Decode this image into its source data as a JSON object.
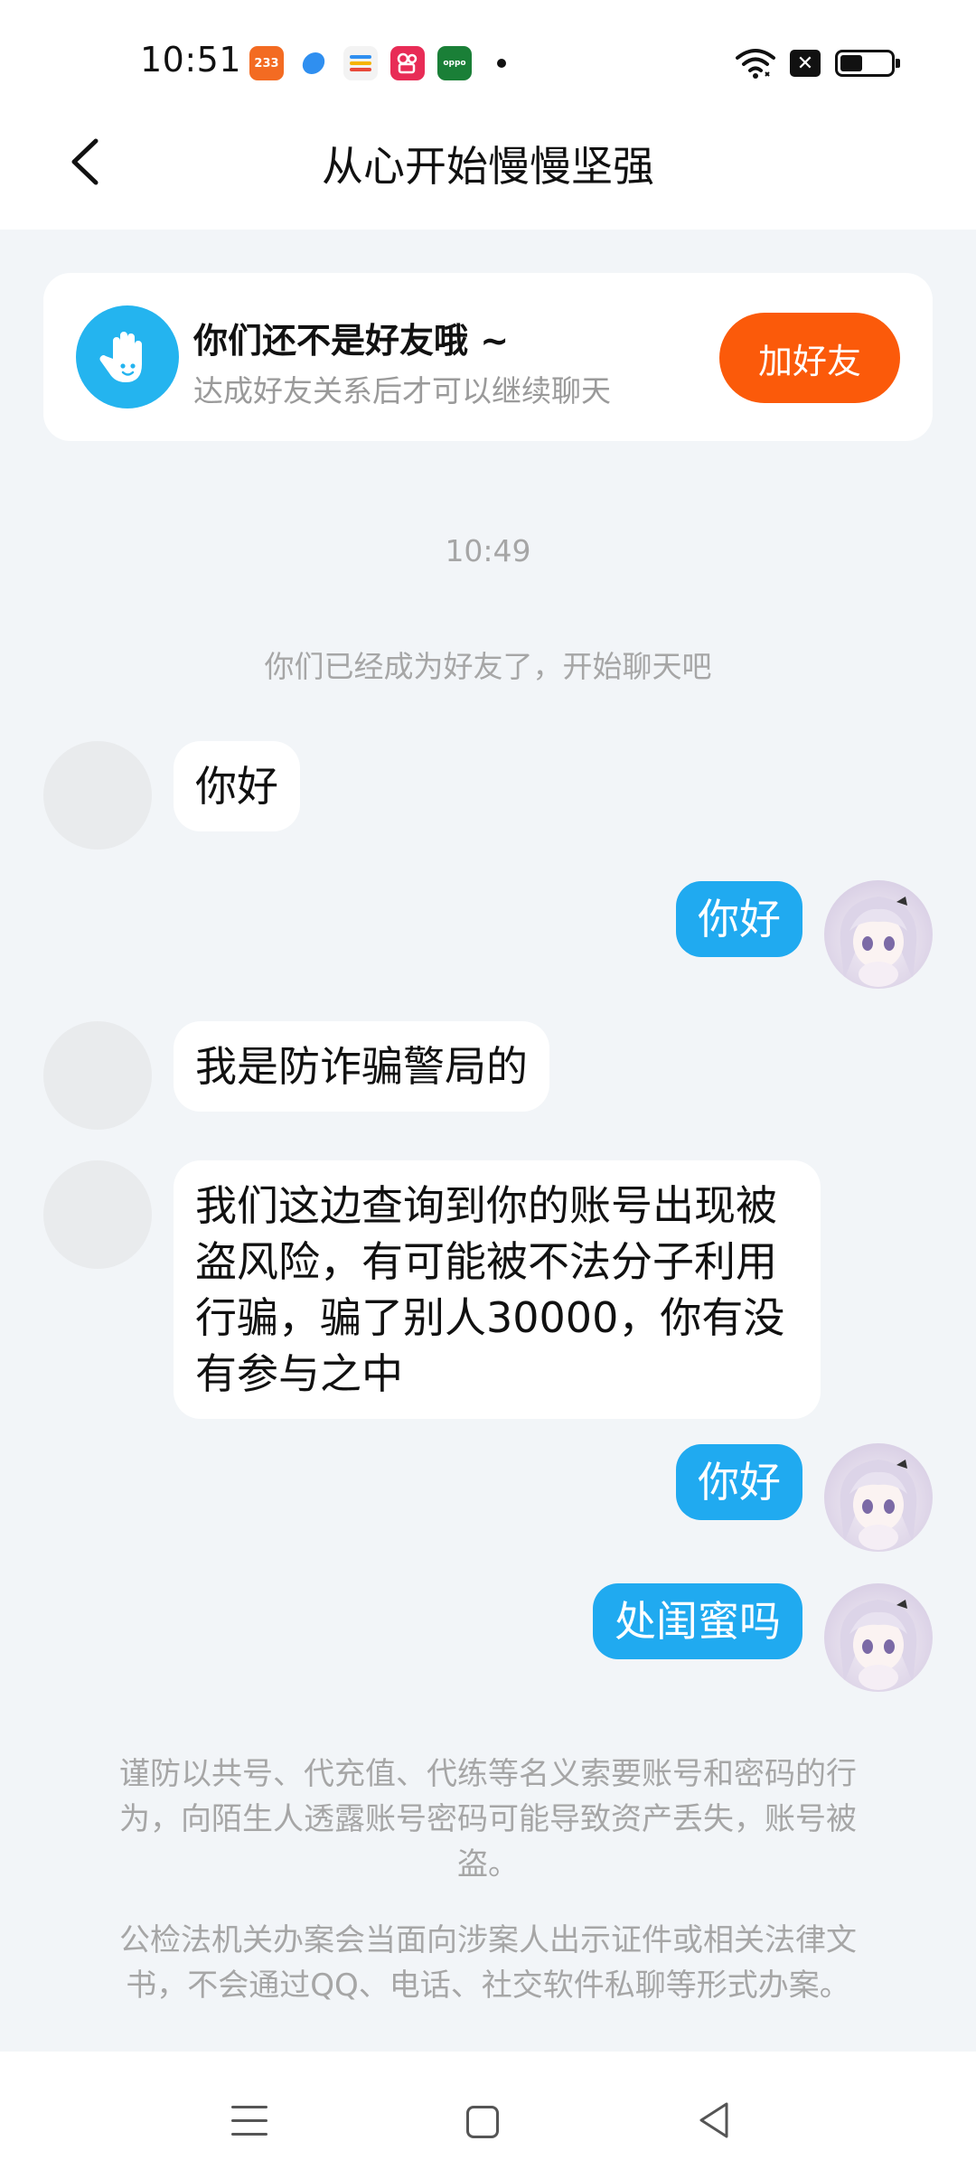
{
  "status_bar": {
    "time": "10:51",
    "notification_icons": [
      "233-app-icon",
      "blue-app-icon",
      "wallet-app-icon",
      "kuaishou-app-icon",
      "oppo-app-icon"
    ],
    "notification_labels": {
      "app_233": "233",
      "app_oppo": "oppo"
    },
    "system_icons": [
      "wifi-icon",
      "sim-blocked-icon",
      "battery-icon"
    ],
    "battery_level": 0.45
  },
  "header": {
    "title": "从心开始慢慢坚强",
    "back_icon": "chevron-left-icon"
  },
  "friend_card": {
    "title": "你们还不是好友哦 ~",
    "subtitle": "达成好友关系后才可以继续聊天",
    "button_label": "加好友",
    "avatar_icon": "waving-hand-icon"
  },
  "chat": {
    "timestamp": "10:49",
    "system_message": "你们已经成为好友了，开始聊天吧",
    "messages": [
      {
        "from": "other",
        "text": "你好"
      },
      {
        "from": "me",
        "text": "你好"
      },
      {
        "from": "other",
        "text": "我是防诈骗警局的"
      },
      {
        "from": "other",
        "text": "我们这边查询到你的账号出现被盗风险，有可能被不法分子利用行骗，骗了别人30000，你有没有参与之中"
      },
      {
        "from": "me",
        "text": "你好"
      },
      {
        "from": "me",
        "text": "处闺蜜吗"
      }
    ]
  },
  "warnings": [
    "谨防以共号、代充值、代练等名义索要账号和密码的行为，向陌生人透露账号密码可能导致资产丢失，账号被盗。",
    "公检法机关办案会当面向涉案人出示证件或相关法律文书，不会通过QQ、电话、社交软件私聊等形式办案。"
  ],
  "bottom_nav": [
    "menu-icon",
    "home-icon",
    "back-icon"
  ],
  "colors": {
    "background": "#f2f5f8",
    "outgoing_bubble": "#20aaf0",
    "add_friend_button": "#fb5a0a",
    "friend_avatar": "#24b4ef"
  }
}
